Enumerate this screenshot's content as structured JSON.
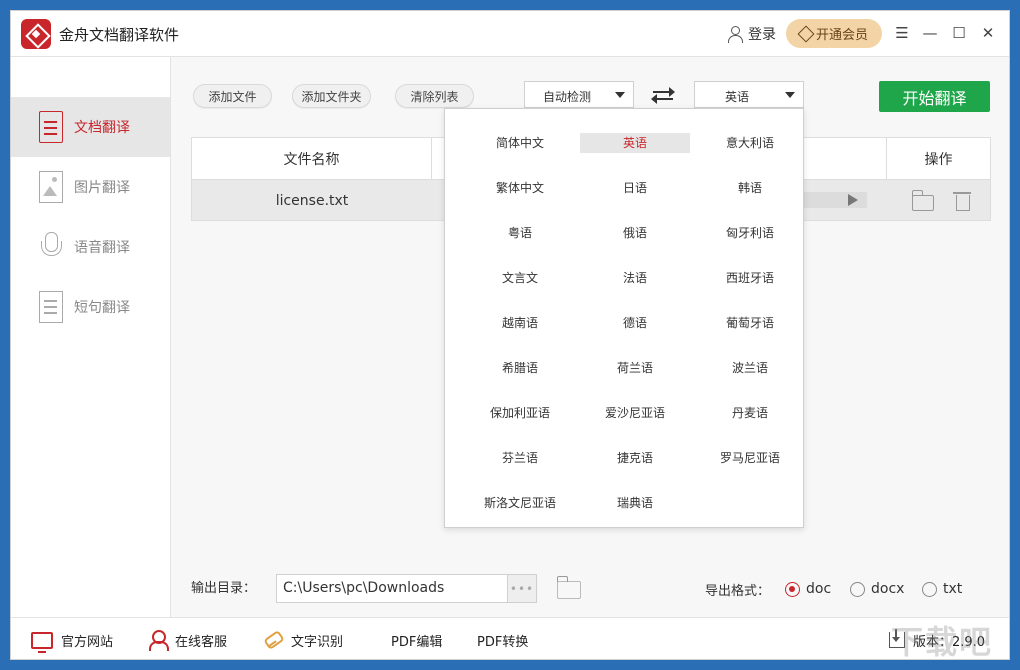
{
  "app": {
    "title": "金舟文档翻译软件"
  },
  "header": {
    "login_label": "登录",
    "vip_label": "开通会员"
  },
  "sidebar": {
    "items": [
      {
        "label": "文档翻译"
      },
      {
        "label": "图片翻译"
      },
      {
        "label": "语音翻译"
      },
      {
        "label": "短句翻译"
      }
    ]
  },
  "toolbar": {
    "add_file": "添加文件",
    "add_folder": "添加文件夹",
    "clear_list": "清除列表",
    "source_lang": "自动检测",
    "target_lang": "英语",
    "start_label": "开始翻译"
  },
  "table": {
    "col_name": "文件名称",
    "col_action": "操作",
    "rows": [
      {
        "name": "license.txt"
      }
    ]
  },
  "dropdown": {
    "selected": "英语",
    "col1": [
      "简体中文",
      "繁体中文",
      "粤语",
      "文言文",
      "越南语",
      "希腊语",
      "保加利亚语",
      "芬兰语",
      "斯洛文尼亚语"
    ],
    "col2": [
      "英语",
      "日语",
      "俄语",
      "法语",
      "德语",
      "荷兰语",
      "爱沙尼亚语",
      "捷克语",
      "瑞典语"
    ],
    "col3": [
      "意大利语",
      "韩语",
      "匈牙利语",
      "西班牙语",
      "葡萄牙语",
      "波兰语",
      "丹麦语",
      "罗马尼亚语"
    ]
  },
  "output": {
    "label": "输出目录：",
    "path": "C:\\Users\\pc\\Downloads",
    "dots": "•••",
    "format_label": "导出格式：",
    "formats": [
      "doc",
      "docx",
      "txt"
    ],
    "selected_format": "doc"
  },
  "footer": {
    "website": "官方网站",
    "service": "在线客服",
    "ocr": "文字识别",
    "pdf_edit": "PDF编辑",
    "pdf_convert": "PDF转换",
    "version": "版本：2.9.0"
  },
  "watermark": "下载吧",
  "colors": {
    "brand": "#c8262b",
    "start": "#1fa64a",
    "vip": "#f2d4a6"
  }
}
